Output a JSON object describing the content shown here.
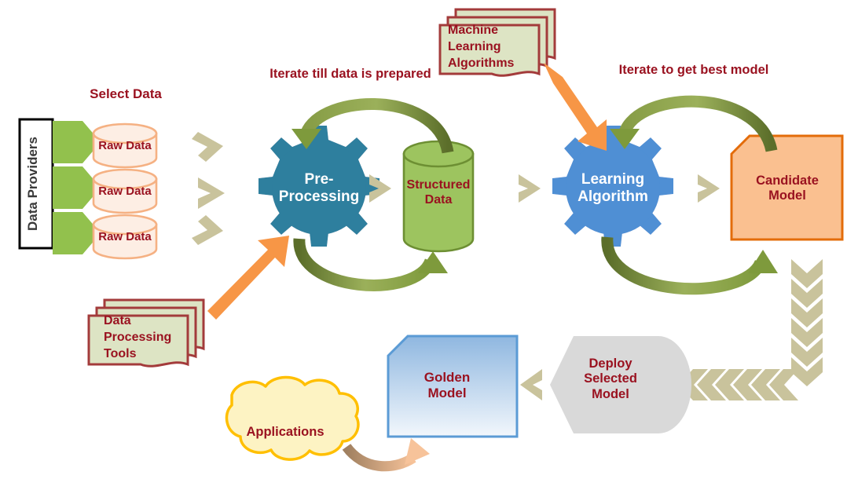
{
  "diagram": {
    "title": "Machine Learning Model Development Pipeline",
    "colors": {
      "dark_red_text": "#9a1220",
      "white_text": "#ffffff",
      "green_arrow": "#77933c",
      "green_arrow_dark": "#5b6e2a",
      "green_block": "#92c14d",
      "teal_gear": "#2e7f9e",
      "blue_gear": "#4f8fd4",
      "orange_arrow": "#f79646",
      "orange_fill": "#fac090",
      "orange_stroke": "#e36c0a",
      "tan_chevron": "#c9c39c",
      "doc_fill": "#dde4c4",
      "doc_stroke": "#a33b3b",
      "cylinder_fill": "#fdeee4",
      "cylinder_stroke": "#f5b183",
      "struct_fill": "#9dc45f",
      "struct_stroke": "#6d8f33",
      "gray_fill": "#d9d9d9",
      "cloud_fill": "#fdf3c3",
      "cloud_stroke": "#ffbf00",
      "golden_top": "#93b9e0",
      "golden_bottom": "#eef4fb",
      "golden_stroke": "#5b9bd5"
    },
    "labels": {
      "data_providers": "Data Providers",
      "select_data": "Select Data",
      "raw_data_1": "Raw Data",
      "raw_data_2": "Raw Data",
      "raw_data_3": "Raw Data",
      "iterate_prepared": "Iterate till data is prepared",
      "iterate_best_model": "Iterate to get best model",
      "pre_processing": "Pre-\nProcessing",
      "structured_data": "Structured\nData",
      "learning_algorithm": "Learning\nAlgorithm",
      "candidate_model": "Candidate\nModel",
      "ml_algorithms": "Machine\nLearning\nAlgorithms",
      "data_processing_tools": "Data\nProcessing\nTools",
      "deploy_selected_model": "Deploy\nSelected\nModel",
      "golden_model": "Golden\nModel",
      "applications": "Applications"
    },
    "nodes": [
      {
        "id": "data-providers",
        "label": "Data Providers",
        "shape": "vertical-box"
      },
      {
        "id": "raw-data-1",
        "label": "Raw Data",
        "shape": "cylinder"
      },
      {
        "id": "raw-data-2",
        "label": "Raw Data",
        "shape": "cylinder"
      },
      {
        "id": "raw-data-3",
        "label": "Raw Data",
        "shape": "cylinder"
      },
      {
        "id": "pre-processing",
        "label": "Pre-Processing",
        "shape": "gear"
      },
      {
        "id": "structured-data",
        "label": "Structured Data",
        "shape": "cylinder"
      },
      {
        "id": "learning-algorithm",
        "label": "Learning Algorithm",
        "shape": "gear"
      },
      {
        "id": "candidate-model",
        "label": "Candidate Model",
        "shape": "cut-corner-rect"
      },
      {
        "id": "ml-algorithms",
        "label": "Machine Learning Algorithms",
        "shape": "document-stack"
      },
      {
        "id": "data-processing-tools",
        "label": "Data Processing Tools",
        "shape": "document-stack"
      },
      {
        "id": "deploy-selected-model",
        "label": "Deploy Selected Model",
        "shape": "hexagon"
      },
      {
        "id": "golden-model",
        "label": "Golden Model",
        "shape": "cut-corner-rect"
      },
      {
        "id": "applications",
        "label": "Applications",
        "shape": "cloud"
      }
    ]
  }
}
